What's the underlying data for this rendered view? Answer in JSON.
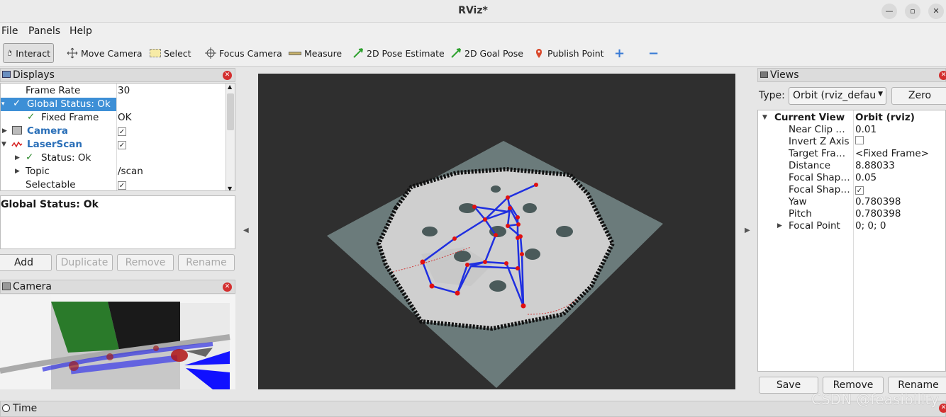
{
  "window": {
    "title": "RViz*"
  },
  "menu": {
    "file": "File",
    "panels": "Panels",
    "help": "Help"
  },
  "toolbar": {
    "interact": "Interact",
    "move_camera": "Move Camera",
    "select": "Select",
    "focus_camera": "Focus Camera",
    "measure": "Measure",
    "pose_estimate": "2D Pose Estimate",
    "goal_pose": "2D Goal Pose",
    "publish_point": "Publish Point",
    "add_tool": "+",
    "remove_tool": "−"
  },
  "displays": {
    "title": "Displays",
    "rows": [
      {
        "label": "Frame Rate",
        "value": "30"
      },
      {
        "label": "Global Status: Ok",
        "value": ""
      },
      {
        "label": "Fixed Frame",
        "value": "OK"
      },
      {
        "label": "Camera",
        "value": "✓"
      },
      {
        "label": "LaserScan",
        "value": "✓"
      },
      {
        "label": "Status: Ok",
        "value": ""
      },
      {
        "label": "Topic",
        "value": "/scan"
      },
      {
        "label": "Selectable",
        "value": "✓"
      }
    ],
    "description": "Global Status: Ok",
    "buttons": {
      "add": "Add",
      "duplicate": "Duplicate",
      "remove": "Remove",
      "rename": "Rename"
    }
  },
  "camera_panel": {
    "title": "Camera"
  },
  "views": {
    "title": "Views",
    "type_label": "Type:",
    "type_value": "Orbit (rviz_defau",
    "zero": "Zero",
    "header_key": "Current View",
    "header_value": "Orbit (rviz)",
    "rows": [
      {
        "label": "Near Clip …",
        "value": "0.01"
      },
      {
        "label": "Invert Z Axis",
        "value": ""
      },
      {
        "label": "Target Fra…",
        "value": "<Fixed Frame>"
      },
      {
        "label": "Distance",
        "value": "8.88033"
      },
      {
        "label": "Focal Shap…",
        "value": "0.05"
      },
      {
        "label": "Focal Shap…",
        "value": "✓"
      },
      {
        "label": "Yaw",
        "value": "0.780398"
      },
      {
        "label": "Pitch",
        "value": "0.780398"
      },
      {
        "label": "Focal Point",
        "value": "0; 0; 0"
      }
    ],
    "buttons": {
      "save": "Save",
      "remove": "Remove",
      "rename": "Rename"
    }
  },
  "time_panel": {
    "title": "Time"
  },
  "watermark": "CSDN @feasibility",
  "colors": {
    "selection": "#3d8fd6",
    "graph_edges": "#1f2fe0",
    "graph_nodes": "#e01010",
    "close_button": "#d32f2f"
  }
}
